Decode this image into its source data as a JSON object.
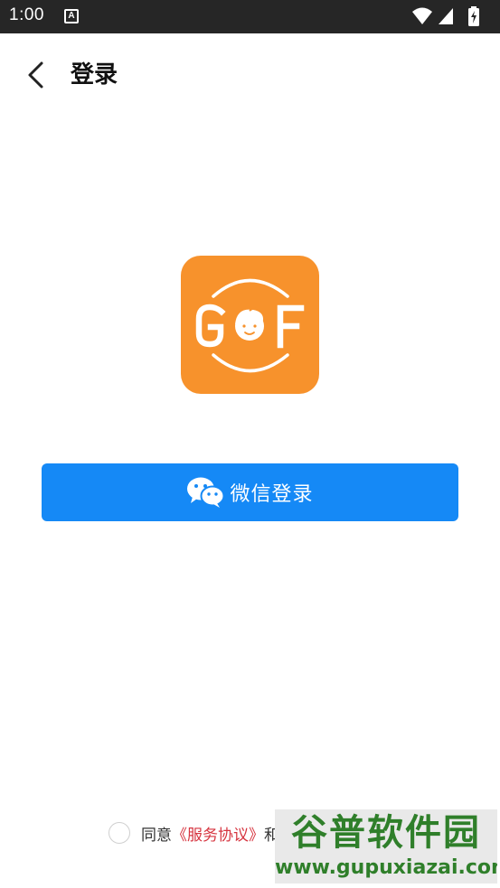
{
  "status_bar": {
    "time": "1:00",
    "notification_glyph": "A",
    "icons": [
      "wifi-icon",
      "signal-icon",
      "battery-charging-icon"
    ]
  },
  "app_bar": {
    "back_icon": "chevron-left-icon",
    "title": "登录"
  },
  "logo": {
    "icon": "gof-app-logo",
    "text": "GOF",
    "background": "#f7922c"
  },
  "wechat_login": {
    "icon": "wechat-icon",
    "label": "微信登录",
    "background": "#1589f6"
  },
  "agreement": {
    "prefix": "同意",
    "link": "《服务协议》",
    "suffix": "和"
  },
  "watermark": {
    "name": "谷普软件园",
    "url": "www.gupuxiazai.com"
  },
  "colors": {
    "accent": "#1589f6",
    "link": "#d6343f",
    "status_bar": "#262626"
  }
}
